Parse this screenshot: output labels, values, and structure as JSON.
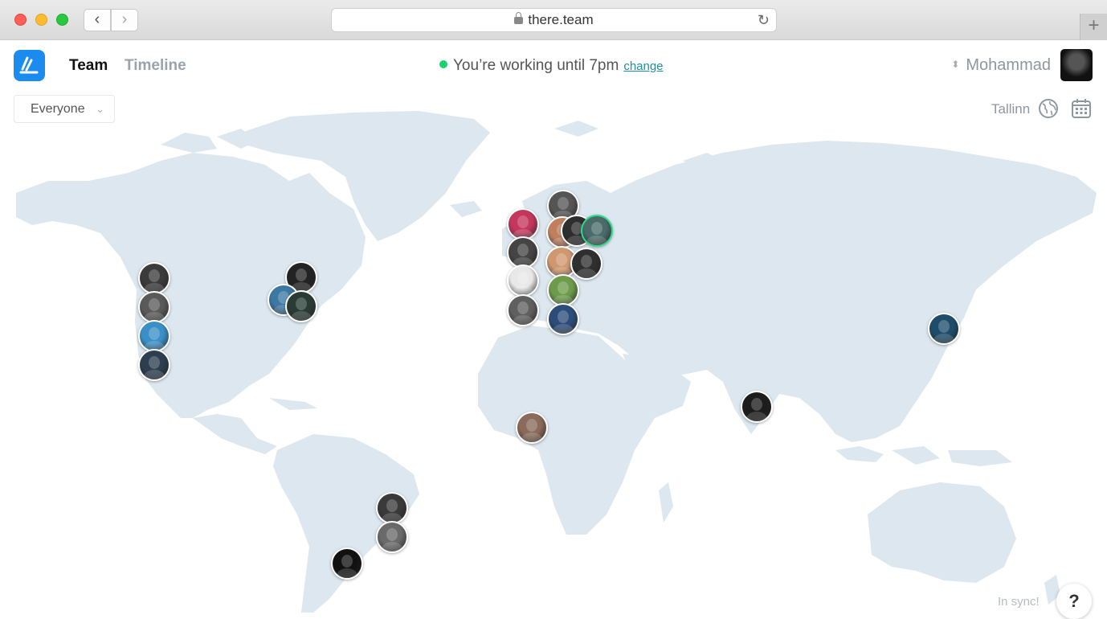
{
  "browser": {
    "url": "there.team",
    "back_icon": "chevron-left-icon",
    "forward_icon": "chevron-right-icon"
  },
  "header": {
    "nav": {
      "team": "Team",
      "timeline": "Timeline"
    },
    "status_text": "You’re working until 7pm",
    "status_link": "change",
    "user_name": "Mohammad"
  },
  "toolbar": {
    "filter_value": "Everyone",
    "location": "Tallinn"
  },
  "footer": {
    "sync_text": "In sync!",
    "help_label": "?"
  },
  "colors": {
    "accent": "#1a8cf0",
    "status": "#19d46a",
    "link": "#1f8e9e",
    "map_land": "#dce7ef"
  },
  "team_avatars": [
    {
      "name": "member-1",
      "color": "#3b3b3b"
    },
    {
      "name": "member-2",
      "color": "#5a5a5a"
    },
    {
      "name": "member-3",
      "color": "#3a8fc7"
    },
    {
      "name": "member-4",
      "color": "#2c3e50"
    },
    {
      "name": "member-5",
      "color": "#232323"
    },
    {
      "name": "member-6",
      "color": "#3d78a3"
    },
    {
      "name": "member-7",
      "color": "#2a3b36"
    },
    {
      "name": "member-8",
      "color": "#555555"
    },
    {
      "name": "member-9",
      "color": "#c4365c"
    },
    {
      "name": "member-10",
      "color": "#c08060"
    },
    {
      "name": "member-11",
      "color": "#2e2e2e"
    },
    {
      "name": "member-12",
      "color": "#4b6b6b"
    },
    {
      "name": "member-13",
      "color": "#444444"
    },
    {
      "name": "member-14",
      "color": "#d09870"
    },
    {
      "name": "member-15",
      "color": "#2f2f2f"
    },
    {
      "name": "member-16",
      "color": "#e8e8e8"
    },
    {
      "name": "member-17",
      "color": "#6c9b4a"
    },
    {
      "name": "member-18",
      "color": "#5f5f5f"
    },
    {
      "name": "member-19",
      "color": "#2c4c7a"
    },
    {
      "name": "member-20",
      "color": "#1e4d6b"
    },
    {
      "name": "member-21",
      "color": "#8a6a5a"
    },
    {
      "name": "member-22",
      "color": "#1c1c1c"
    },
    {
      "name": "member-23",
      "color": "#3a3a3a"
    },
    {
      "name": "member-24",
      "color": "#6a6a6a"
    },
    {
      "name": "member-25",
      "color": "#111111"
    }
  ]
}
